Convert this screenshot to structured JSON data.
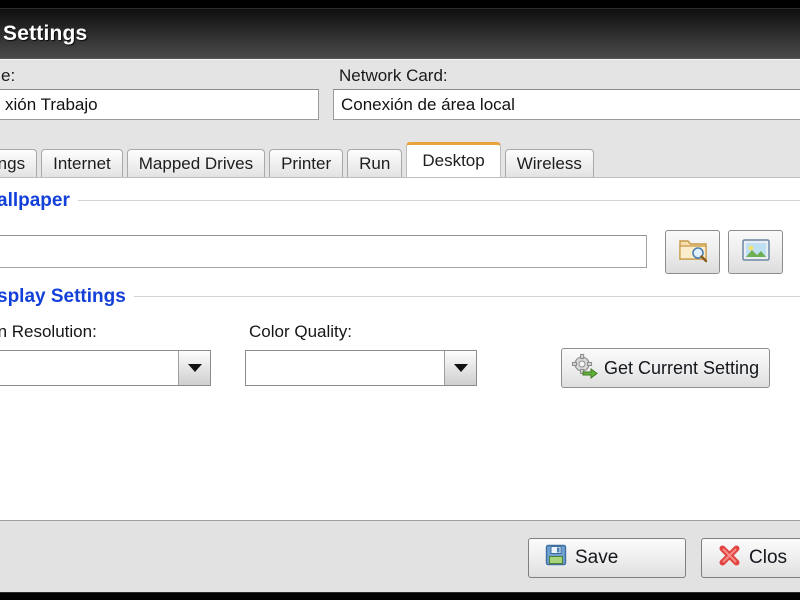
{
  "window": {
    "title": "Settings",
    "title_truncated_left": true
  },
  "top_form": {
    "name_label": "e:",
    "name_value": "xión Trabajo",
    "network_card_label": "Network Card:",
    "network_card_value": "Conexión de área local"
  },
  "tabs": [
    {
      "label": "ettings",
      "active": false
    },
    {
      "label": "Internet",
      "active": false
    },
    {
      "label": "Mapped Drives",
      "active": false
    },
    {
      "label": "Printer",
      "active": false
    },
    {
      "label": "Run",
      "active": false
    },
    {
      "label": "Desktop",
      "active": true
    },
    {
      "label": "Wireless",
      "active": false
    }
  ],
  "desktop_tab": {
    "wallpaper": {
      "section_title": "allpaper",
      "path_value": "",
      "path_placeholder": "",
      "browse_icon": "folder-search-icon",
      "preview_icon": "picture-icon"
    },
    "display_settings": {
      "section_title": "splay Settings",
      "screen_resolution_label": "reen Resolution:",
      "screen_resolution_value": "",
      "color_quality_label": "Color Quality:",
      "color_quality_value": "",
      "dropdown_icon": "chevron-down-icon",
      "get_current_label": "Get Current Setting",
      "get_current_icon": "gear-refresh-icon"
    }
  },
  "footer": {
    "save_label": "Save",
    "save_icon": "floppy-disk-icon",
    "close_label": "Clos",
    "close_icon": "red-x-icon"
  },
  "colors": {
    "accent_tab": "#e8a33d",
    "section_heading": "#1340d8",
    "titlebar_dark": "#0f0f0f",
    "dialog_face": "#e4e4e4",
    "close_red": "#e03a35",
    "save_blue": "#5b8fc9",
    "save_green": "#9ccf6a"
  }
}
